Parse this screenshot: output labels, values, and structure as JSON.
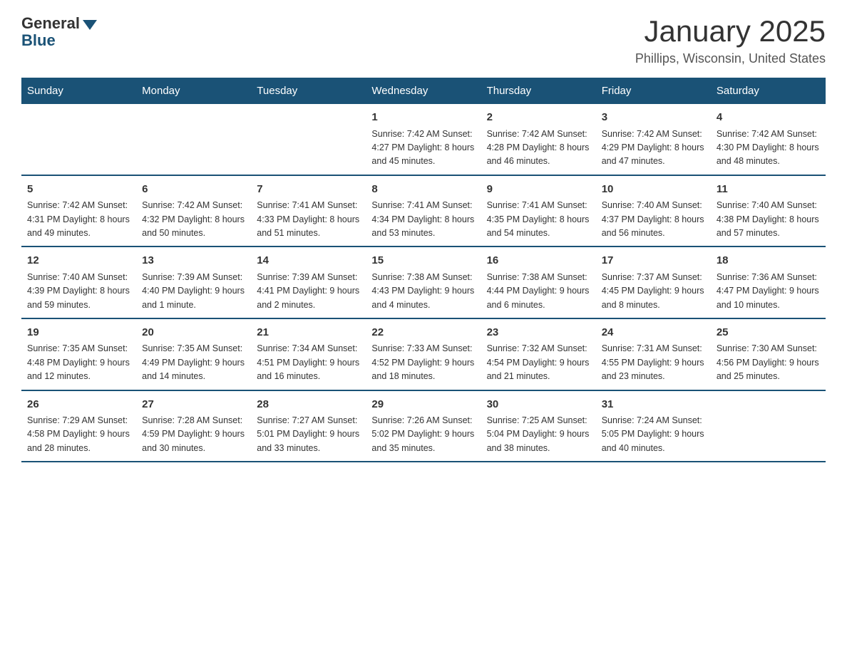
{
  "header": {
    "logo_general": "General",
    "logo_blue": "Blue",
    "main_title": "January 2025",
    "subtitle": "Phillips, Wisconsin, United States"
  },
  "days_of_week": [
    "Sunday",
    "Monday",
    "Tuesday",
    "Wednesday",
    "Thursday",
    "Friday",
    "Saturday"
  ],
  "weeks": [
    [
      {
        "day": "",
        "info": ""
      },
      {
        "day": "",
        "info": ""
      },
      {
        "day": "",
        "info": ""
      },
      {
        "day": "1",
        "info": "Sunrise: 7:42 AM\nSunset: 4:27 PM\nDaylight: 8 hours\nand 45 minutes."
      },
      {
        "day": "2",
        "info": "Sunrise: 7:42 AM\nSunset: 4:28 PM\nDaylight: 8 hours\nand 46 minutes."
      },
      {
        "day": "3",
        "info": "Sunrise: 7:42 AM\nSunset: 4:29 PM\nDaylight: 8 hours\nand 47 minutes."
      },
      {
        "day": "4",
        "info": "Sunrise: 7:42 AM\nSunset: 4:30 PM\nDaylight: 8 hours\nand 48 minutes."
      }
    ],
    [
      {
        "day": "5",
        "info": "Sunrise: 7:42 AM\nSunset: 4:31 PM\nDaylight: 8 hours\nand 49 minutes."
      },
      {
        "day": "6",
        "info": "Sunrise: 7:42 AM\nSunset: 4:32 PM\nDaylight: 8 hours\nand 50 minutes."
      },
      {
        "day": "7",
        "info": "Sunrise: 7:41 AM\nSunset: 4:33 PM\nDaylight: 8 hours\nand 51 minutes."
      },
      {
        "day": "8",
        "info": "Sunrise: 7:41 AM\nSunset: 4:34 PM\nDaylight: 8 hours\nand 53 minutes."
      },
      {
        "day": "9",
        "info": "Sunrise: 7:41 AM\nSunset: 4:35 PM\nDaylight: 8 hours\nand 54 minutes."
      },
      {
        "day": "10",
        "info": "Sunrise: 7:40 AM\nSunset: 4:37 PM\nDaylight: 8 hours\nand 56 minutes."
      },
      {
        "day": "11",
        "info": "Sunrise: 7:40 AM\nSunset: 4:38 PM\nDaylight: 8 hours\nand 57 minutes."
      }
    ],
    [
      {
        "day": "12",
        "info": "Sunrise: 7:40 AM\nSunset: 4:39 PM\nDaylight: 8 hours\nand 59 minutes."
      },
      {
        "day": "13",
        "info": "Sunrise: 7:39 AM\nSunset: 4:40 PM\nDaylight: 9 hours\nand 1 minute."
      },
      {
        "day": "14",
        "info": "Sunrise: 7:39 AM\nSunset: 4:41 PM\nDaylight: 9 hours\nand 2 minutes."
      },
      {
        "day": "15",
        "info": "Sunrise: 7:38 AM\nSunset: 4:43 PM\nDaylight: 9 hours\nand 4 minutes."
      },
      {
        "day": "16",
        "info": "Sunrise: 7:38 AM\nSunset: 4:44 PM\nDaylight: 9 hours\nand 6 minutes."
      },
      {
        "day": "17",
        "info": "Sunrise: 7:37 AM\nSunset: 4:45 PM\nDaylight: 9 hours\nand 8 minutes."
      },
      {
        "day": "18",
        "info": "Sunrise: 7:36 AM\nSunset: 4:47 PM\nDaylight: 9 hours\nand 10 minutes."
      }
    ],
    [
      {
        "day": "19",
        "info": "Sunrise: 7:35 AM\nSunset: 4:48 PM\nDaylight: 9 hours\nand 12 minutes."
      },
      {
        "day": "20",
        "info": "Sunrise: 7:35 AM\nSunset: 4:49 PM\nDaylight: 9 hours\nand 14 minutes."
      },
      {
        "day": "21",
        "info": "Sunrise: 7:34 AM\nSunset: 4:51 PM\nDaylight: 9 hours\nand 16 minutes."
      },
      {
        "day": "22",
        "info": "Sunrise: 7:33 AM\nSunset: 4:52 PM\nDaylight: 9 hours\nand 18 minutes."
      },
      {
        "day": "23",
        "info": "Sunrise: 7:32 AM\nSunset: 4:54 PM\nDaylight: 9 hours\nand 21 minutes."
      },
      {
        "day": "24",
        "info": "Sunrise: 7:31 AM\nSunset: 4:55 PM\nDaylight: 9 hours\nand 23 minutes."
      },
      {
        "day": "25",
        "info": "Sunrise: 7:30 AM\nSunset: 4:56 PM\nDaylight: 9 hours\nand 25 minutes."
      }
    ],
    [
      {
        "day": "26",
        "info": "Sunrise: 7:29 AM\nSunset: 4:58 PM\nDaylight: 9 hours\nand 28 minutes."
      },
      {
        "day": "27",
        "info": "Sunrise: 7:28 AM\nSunset: 4:59 PM\nDaylight: 9 hours\nand 30 minutes."
      },
      {
        "day": "28",
        "info": "Sunrise: 7:27 AM\nSunset: 5:01 PM\nDaylight: 9 hours\nand 33 minutes."
      },
      {
        "day": "29",
        "info": "Sunrise: 7:26 AM\nSunset: 5:02 PM\nDaylight: 9 hours\nand 35 minutes."
      },
      {
        "day": "30",
        "info": "Sunrise: 7:25 AM\nSunset: 5:04 PM\nDaylight: 9 hours\nand 38 minutes."
      },
      {
        "day": "31",
        "info": "Sunrise: 7:24 AM\nSunset: 5:05 PM\nDaylight: 9 hours\nand 40 minutes."
      },
      {
        "day": "",
        "info": ""
      }
    ]
  ]
}
